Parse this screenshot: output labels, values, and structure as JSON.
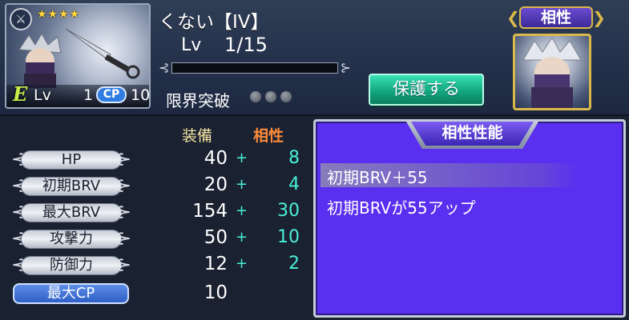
{
  "unit": {
    "stars": "★★★★",
    "name": "くない【IV】",
    "level_label": "Lv",
    "level_value": "1/15",
    "exp_fraction": 0.0,
    "limit_break_label": "限界突破",
    "limit_break_pips": 3,
    "protect_button": "保護する"
  },
  "portrait": {
    "e_mark": "E",
    "lv_label": "Lv",
    "lv_value": "1",
    "cp_label": "CP",
    "cp_value": "10"
  },
  "affinity_tag": "相性",
  "stats": {
    "header_equip": "装備",
    "header_affinity": "相性",
    "rows": [
      {
        "label": "HP",
        "value": "40",
        "plus": "+",
        "bonus": "8"
      },
      {
        "label": "初期BRV",
        "value": "20",
        "plus": "+",
        "bonus": "4"
      },
      {
        "label": "最大BRV",
        "value": "154",
        "plus": "+",
        "bonus": "30"
      },
      {
        "label": "攻撃力",
        "value": "50",
        "plus": "+",
        "bonus": "10"
      },
      {
        "label": "防御力",
        "value": "12",
        "plus": "+",
        "bonus": "2"
      }
    ],
    "max_cp_label": "最大CP",
    "max_cp_value": "10"
  },
  "affinity_panel": {
    "title": "相性性能",
    "effect_name": "初期BRV＋55",
    "effect_desc": "初期BRVが55アップ"
  },
  "colors": {
    "affinity_panel_bg": "#5a2ff0",
    "bonus_text": "#4af0d8",
    "protect_button": "#13a87f",
    "affinity_header": "#ff8c3a"
  }
}
